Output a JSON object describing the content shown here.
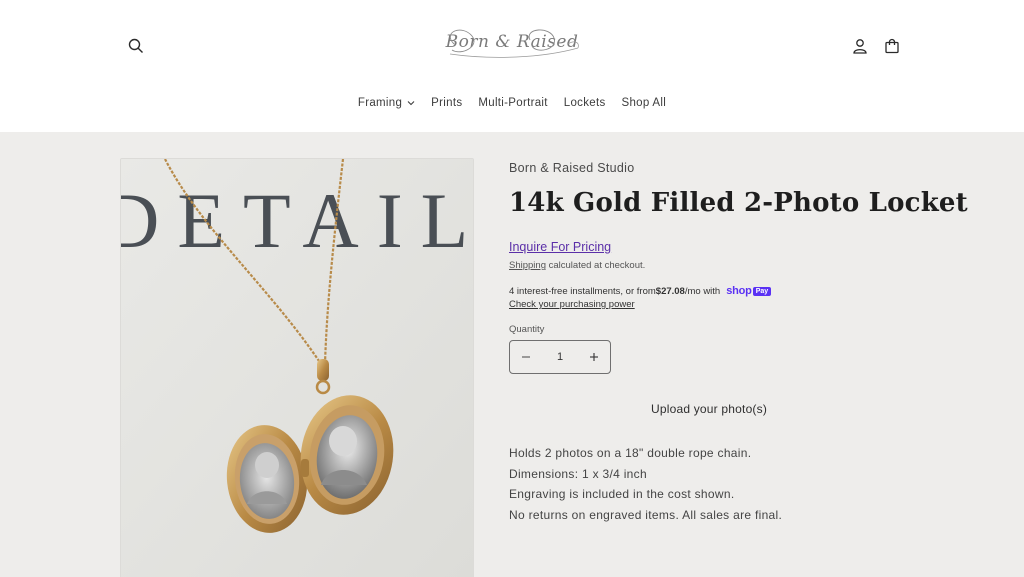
{
  "header": {
    "logo_text": "Born & Raised",
    "icons": {
      "search": "search-icon",
      "account": "account-icon",
      "cart": "cart-icon"
    }
  },
  "nav": {
    "items": [
      {
        "label": "Framing",
        "has_dropdown": true
      },
      {
        "label": "Prints"
      },
      {
        "label": "Multi-Portrait"
      },
      {
        "label": "Lockets"
      },
      {
        "label": "Shop All"
      }
    ]
  },
  "product": {
    "vendor": "Born & Raised Studio",
    "title": "14k Gold Filled 2-Photo Locket",
    "inquire_label": "Inquire For Pricing",
    "shipping_link": "Shipping",
    "shipping_text": " calculated at checkout.",
    "installments_prefix": "4 interest-free installments, or from ",
    "installments_amount": "$27.08",
    "installments_suffix": "/mo with",
    "shop_pay_word": "shop",
    "shop_pay_badge": "Pay",
    "purchasing_power_link": "Check your purchasing power",
    "quantity_label": "Quantity",
    "quantity_value": "1",
    "upload_label": "Upload your photo(s)",
    "description": [
      "Holds 2 photos on a 18\" double rope chain.",
      "Dimensions: 1 x 3/4 inch",
      "Engraving is included in the cost shown.",
      "No returns on engraved items. All sales are final."
    ],
    "image_backdrop_text": "DETAIL"
  },
  "colors": {
    "accent_link": "#5b2fa8",
    "shop_pay": "#5a31f4",
    "main_background": "#eeedeb"
  }
}
